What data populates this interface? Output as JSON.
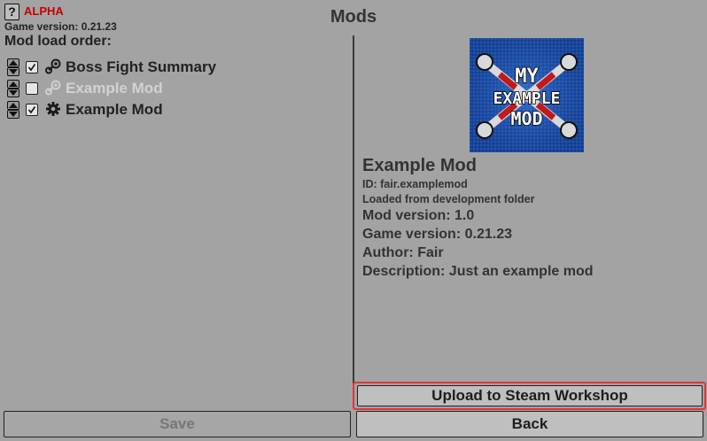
{
  "header": {
    "help_icon": "?",
    "alpha_label": "ALPHA",
    "game_version": "Game version: 0.21.23",
    "title": "Mods"
  },
  "mod_list": {
    "label": "Mod load order:",
    "items": [
      {
        "name": "Boss Fight Summary",
        "enabled": true,
        "source": "steam-icon"
      },
      {
        "name": "Example Mod",
        "enabled": false,
        "source": "steam-icon"
      },
      {
        "name": "Example Mod",
        "enabled": true,
        "source": "gear-icon"
      }
    ]
  },
  "details": {
    "name": "Example Mod",
    "id": "ID: fair.examplemod",
    "loaded_from": "Loaded from development folder",
    "mod_version": "Mod version: 1.0",
    "game_version": "Game version: 0.21.23",
    "author": "Author: Fair",
    "description": "Description: Just an example mod",
    "preview_text": [
      "MY",
      "EXAMPLE",
      "MOD"
    ]
  },
  "buttons": {
    "upload": "Upload to Steam Workshop",
    "save": "Save",
    "back": "Back"
  },
  "colors": {
    "background": "#a3a3a3",
    "alpha": "#c80000",
    "highlight": "#e53535",
    "preview_bg": "#1e4fa8"
  }
}
